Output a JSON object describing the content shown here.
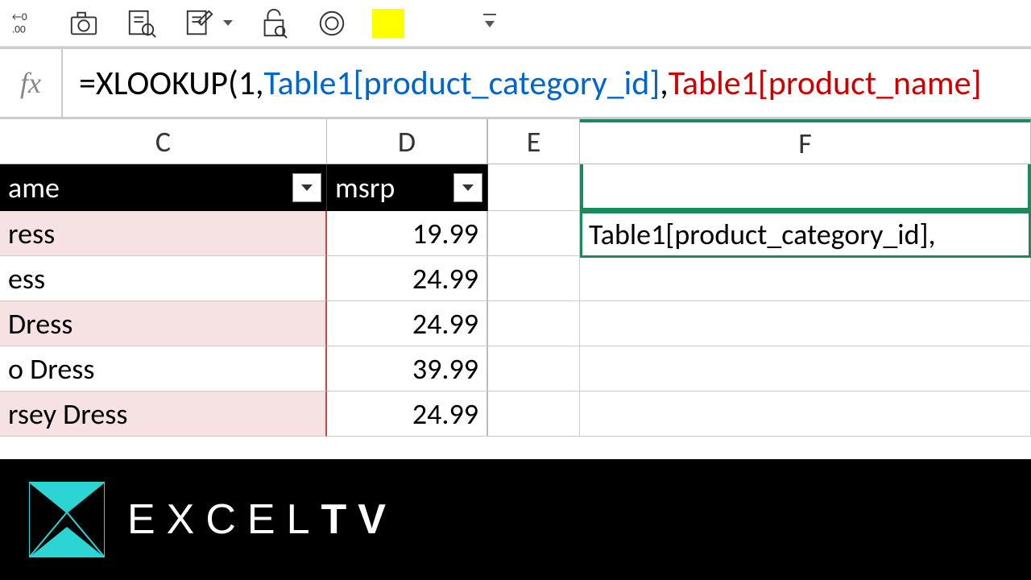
{
  "toolbar": {
    "swatch_color": "#ffff00"
  },
  "formula": {
    "fx_label": "fx",
    "p1": "=XLOOKUP(",
    "p2": "1",
    "p3": ",",
    "p4": "Table1[product_category_id]",
    "p5": ",",
    "p6": "Table1[product_name]"
  },
  "columns": {
    "C": "C",
    "D": "D",
    "E": "E",
    "F": "F"
  },
  "headers": {
    "name": "ame",
    "msrp": "msrp"
  },
  "rows": [
    {
      "c": "ress",
      "d": "19.99",
      "pink": true
    },
    {
      "c": "ess",
      "d": "24.99",
      "pink": false
    },
    {
      "c": "Dress",
      "d": "24.99",
      "pink": true
    },
    {
      "c": "o Dress",
      "d": "39.99",
      "pink": false
    },
    {
      "c": "rsey Dress",
      "d": "24.99",
      "pink": true
    }
  ],
  "edit_cell": "Table1[product_category_id],",
  "brand": {
    "a": "EXCEL",
    "b": "TV"
  }
}
